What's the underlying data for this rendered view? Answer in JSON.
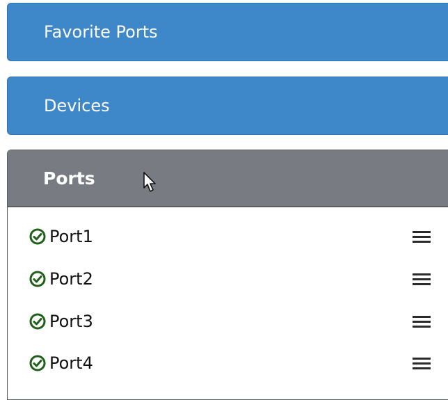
{
  "panels": {
    "favorite_ports": {
      "label": "Favorite Ports"
    },
    "devices": {
      "label": "Devices"
    },
    "ports": {
      "label": "Ports",
      "items": [
        {
          "label": "Port1",
          "status": "ok",
          "status_icon": "check-circle-icon",
          "menu_icon": "hamburger-menu-icon"
        },
        {
          "label": "Port2",
          "status": "ok",
          "status_icon": "check-circle-icon",
          "menu_icon": "hamburger-menu-icon"
        },
        {
          "label": "Port3",
          "status": "ok",
          "status_icon": "check-circle-icon",
          "menu_icon": "hamburger-menu-icon"
        },
        {
          "label": "Port4",
          "status": "ok",
          "status_icon": "check-circle-icon",
          "menu_icon": "hamburger-menu-icon"
        }
      ]
    }
  },
  "colors": {
    "panel_blue": "#3e87c8",
    "panel_gray": "#787c82",
    "status_ok": "#1f5f1a"
  }
}
